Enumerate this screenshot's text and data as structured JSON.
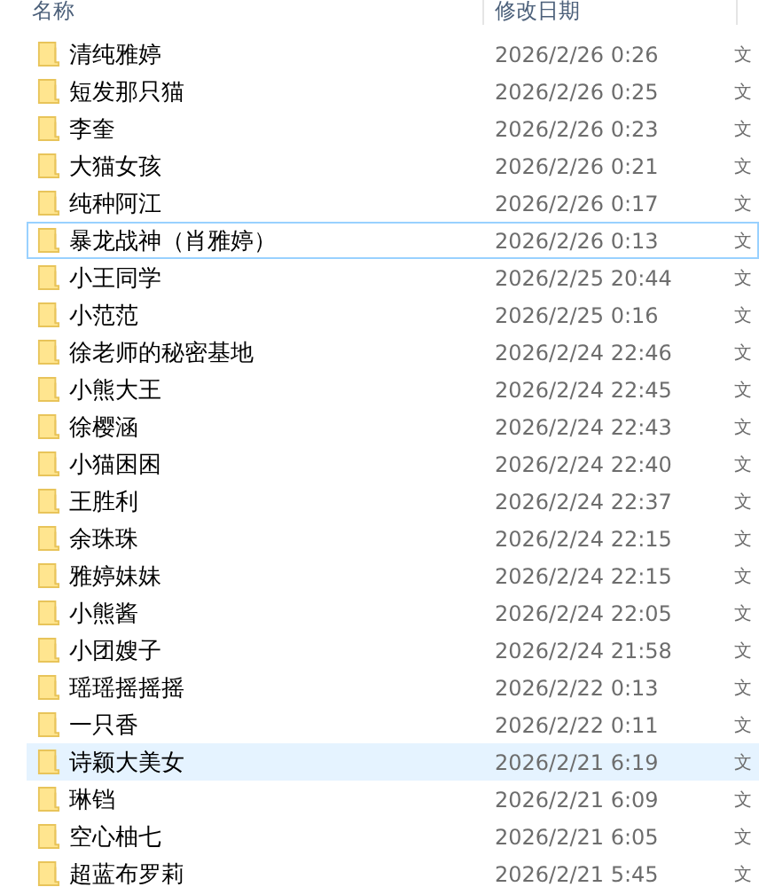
{
  "columns": [
    {
      "label": "名称"
    },
    {
      "label": "修改日期"
    }
  ],
  "rows": [
    {
      "name": "清纯雅婷",
      "modified": "2026/2/26 0:26",
      "type": "文",
      "focused": false,
      "hovered": false
    },
    {
      "name": "短发那只猫",
      "modified": "2026/2/26 0:25",
      "type": "文",
      "focused": false,
      "hovered": false
    },
    {
      "name": "李奎",
      "modified": "2026/2/26 0:23",
      "type": "文",
      "focused": false,
      "hovered": false
    },
    {
      "name": "大猫女孩",
      "modified": "2026/2/26 0:21",
      "type": "文",
      "focused": false,
      "hovered": false
    },
    {
      "name": "纯种阿江",
      "modified": "2026/2/26 0:17",
      "type": "文",
      "focused": false,
      "hovered": false
    },
    {
      "name": "暴龙战神（肖雅婷）",
      "modified": "2026/2/26 0:13",
      "type": "文",
      "focused": true,
      "hovered": false
    },
    {
      "name": "小王同学",
      "modified": "2026/2/25 20:44",
      "type": "文",
      "focused": false,
      "hovered": false
    },
    {
      "name": "小范范",
      "modified": "2026/2/25 0:16",
      "type": "文",
      "focused": false,
      "hovered": false
    },
    {
      "name": "徐老师的秘密基地",
      "modified": "2026/2/24 22:46",
      "type": "文",
      "focused": false,
      "hovered": false
    },
    {
      "name": "小熊大王",
      "modified": "2026/2/24 22:45",
      "type": "文",
      "focused": false,
      "hovered": false
    },
    {
      "name": "徐樱涵",
      "modified": "2026/2/24 22:43",
      "type": "文",
      "focused": false,
      "hovered": false
    },
    {
      "name": "小猫困困",
      "modified": "2026/2/24 22:40",
      "type": "文",
      "focused": false,
      "hovered": false
    },
    {
      "name": "王胜利",
      "modified": "2026/2/24 22:37",
      "type": "文",
      "focused": false,
      "hovered": false
    },
    {
      "name": "余珠珠",
      "modified": "2026/2/24 22:15",
      "type": "文",
      "focused": false,
      "hovered": false
    },
    {
      "name": "雅婷妹妹",
      "modified": "2026/2/24 22:15",
      "type": "文",
      "focused": false,
      "hovered": false
    },
    {
      "name": "小熊酱",
      "modified": "2026/2/24 22:05",
      "type": "文",
      "focused": false,
      "hovered": false
    },
    {
      "name": "小团嫂子",
      "modified": "2026/2/24 21:58",
      "type": "文",
      "focused": false,
      "hovered": false
    },
    {
      "name": "瑶瑶摇摇摇",
      "modified": "2026/2/22 0:13",
      "type": "文",
      "focused": false,
      "hovered": false
    },
    {
      "name": "一只香",
      "modified": "2026/2/22 0:11",
      "type": "文",
      "focused": false,
      "hovered": false
    },
    {
      "name": "诗颖大美女",
      "modified": "2026/2/21 6:19",
      "type": "文",
      "focused": false,
      "hovered": true
    },
    {
      "name": "琳铛",
      "modified": "2026/2/21 6:09",
      "type": "文",
      "focused": false,
      "hovered": false
    },
    {
      "name": "空心柚七",
      "modified": "2026/2/21 6:05",
      "type": "文",
      "focused": false,
      "hovered": false
    },
    {
      "name": "超蓝布罗莉",
      "modified": "2026/2/21 5:45",
      "type": "文",
      "focused": false,
      "hovered": false
    }
  ]
}
